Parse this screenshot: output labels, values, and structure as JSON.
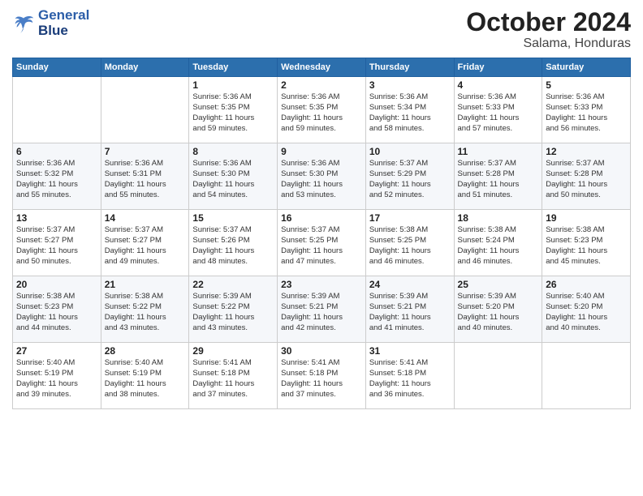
{
  "logo": {
    "line1": "General",
    "line2": "Blue"
  },
  "title": "October 2024",
  "subtitle": "Salama, Honduras",
  "header_days": [
    "Sunday",
    "Monday",
    "Tuesday",
    "Wednesday",
    "Thursday",
    "Friday",
    "Saturday"
  ],
  "weeks": [
    [
      {
        "day": "",
        "info": ""
      },
      {
        "day": "",
        "info": ""
      },
      {
        "day": "1",
        "info": "Sunrise: 5:36 AM\nSunset: 5:35 PM\nDaylight: 11 hours\nand 59 minutes."
      },
      {
        "day": "2",
        "info": "Sunrise: 5:36 AM\nSunset: 5:35 PM\nDaylight: 11 hours\nand 59 minutes."
      },
      {
        "day": "3",
        "info": "Sunrise: 5:36 AM\nSunset: 5:34 PM\nDaylight: 11 hours\nand 58 minutes."
      },
      {
        "day": "4",
        "info": "Sunrise: 5:36 AM\nSunset: 5:33 PM\nDaylight: 11 hours\nand 57 minutes."
      },
      {
        "day": "5",
        "info": "Sunrise: 5:36 AM\nSunset: 5:33 PM\nDaylight: 11 hours\nand 56 minutes."
      }
    ],
    [
      {
        "day": "6",
        "info": "Sunrise: 5:36 AM\nSunset: 5:32 PM\nDaylight: 11 hours\nand 55 minutes."
      },
      {
        "day": "7",
        "info": "Sunrise: 5:36 AM\nSunset: 5:31 PM\nDaylight: 11 hours\nand 55 minutes."
      },
      {
        "day": "8",
        "info": "Sunrise: 5:36 AM\nSunset: 5:30 PM\nDaylight: 11 hours\nand 54 minutes."
      },
      {
        "day": "9",
        "info": "Sunrise: 5:36 AM\nSunset: 5:30 PM\nDaylight: 11 hours\nand 53 minutes."
      },
      {
        "day": "10",
        "info": "Sunrise: 5:37 AM\nSunset: 5:29 PM\nDaylight: 11 hours\nand 52 minutes."
      },
      {
        "day": "11",
        "info": "Sunrise: 5:37 AM\nSunset: 5:28 PM\nDaylight: 11 hours\nand 51 minutes."
      },
      {
        "day": "12",
        "info": "Sunrise: 5:37 AM\nSunset: 5:28 PM\nDaylight: 11 hours\nand 50 minutes."
      }
    ],
    [
      {
        "day": "13",
        "info": "Sunrise: 5:37 AM\nSunset: 5:27 PM\nDaylight: 11 hours\nand 50 minutes."
      },
      {
        "day": "14",
        "info": "Sunrise: 5:37 AM\nSunset: 5:27 PM\nDaylight: 11 hours\nand 49 minutes."
      },
      {
        "day": "15",
        "info": "Sunrise: 5:37 AM\nSunset: 5:26 PM\nDaylight: 11 hours\nand 48 minutes."
      },
      {
        "day": "16",
        "info": "Sunrise: 5:37 AM\nSunset: 5:25 PM\nDaylight: 11 hours\nand 47 minutes."
      },
      {
        "day": "17",
        "info": "Sunrise: 5:38 AM\nSunset: 5:25 PM\nDaylight: 11 hours\nand 46 minutes."
      },
      {
        "day": "18",
        "info": "Sunrise: 5:38 AM\nSunset: 5:24 PM\nDaylight: 11 hours\nand 46 minutes."
      },
      {
        "day": "19",
        "info": "Sunrise: 5:38 AM\nSunset: 5:23 PM\nDaylight: 11 hours\nand 45 minutes."
      }
    ],
    [
      {
        "day": "20",
        "info": "Sunrise: 5:38 AM\nSunset: 5:23 PM\nDaylight: 11 hours\nand 44 minutes."
      },
      {
        "day": "21",
        "info": "Sunrise: 5:38 AM\nSunset: 5:22 PM\nDaylight: 11 hours\nand 43 minutes."
      },
      {
        "day": "22",
        "info": "Sunrise: 5:39 AM\nSunset: 5:22 PM\nDaylight: 11 hours\nand 43 minutes."
      },
      {
        "day": "23",
        "info": "Sunrise: 5:39 AM\nSunset: 5:21 PM\nDaylight: 11 hours\nand 42 minutes."
      },
      {
        "day": "24",
        "info": "Sunrise: 5:39 AM\nSunset: 5:21 PM\nDaylight: 11 hours\nand 41 minutes."
      },
      {
        "day": "25",
        "info": "Sunrise: 5:39 AM\nSunset: 5:20 PM\nDaylight: 11 hours\nand 40 minutes."
      },
      {
        "day": "26",
        "info": "Sunrise: 5:40 AM\nSunset: 5:20 PM\nDaylight: 11 hours\nand 40 minutes."
      }
    ],
    [
      {
        "day": "27",
        "info": "Sunrise: 5:40 AM\nSunset: 5:19 PM\nDaylight: 11 hours\nand 39 minutes."
      },
      {
        "day": "28",
        "info": "Sunrise: 5:40 AM\nSunset: 5:19 PM\nDaylight: 11 hours\nand 38 minutes."
      },
      {
        "day": "29",
        "info": "Sunrise: 5:41 AM\nSunset: 5:18 PM\nDaylight: 11 hours\nand 37 minutes."
      },
      {
        "day": "30",
        "info": "Sunrise: 5:41 AM\nSunset: 5:18 PM\nDaylight: 11 hours\nand 37 minutes."
      },
      {
        "day": "31",
        "info": "Sunrise: 5:41 AM\nSunset: 5:18 PM\nDaylight: 11 hours\nand 36 minutes."
      },
      {
        "day": "",
        "info": ""
      },
      {
        "day": "",
        "info": ""
      }
    ]
  ]
}
